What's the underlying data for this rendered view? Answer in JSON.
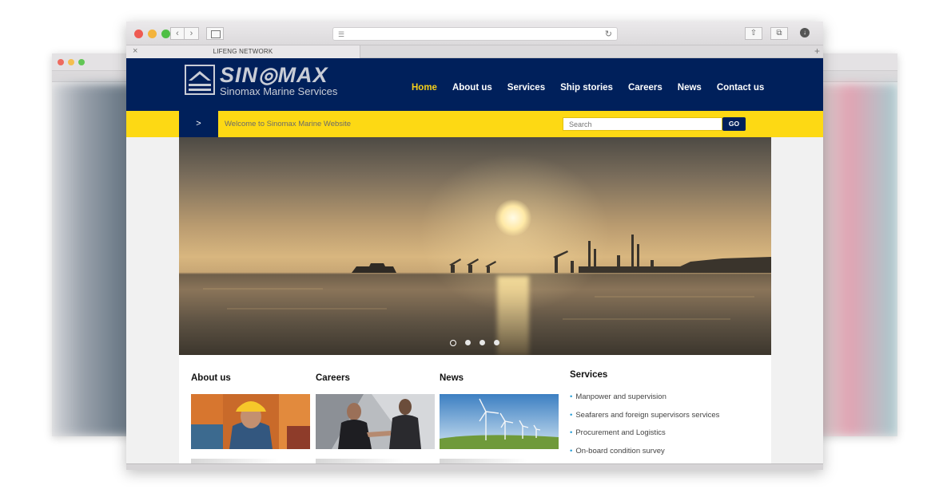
{
  "browser": {
    "tab_title": "LIFENG NETWORK"
  },
  "site": {
    "brand_name": "SIN◎MAX",
    "brand_sub": "Sinomax Marine Services",
    "nav": [
      {
        "label": "Home",
        "active": true
      },
      {
        "label": "About us",
        "active": false
      },
      {
        "label": "Services",
        "active": false
      },
      {
        "label": "Ship stories",
        "active": false
      },
      {
        "label": "Careers",
        "active": false
      },
      {
        "label": "News",
        "active": false
      },
      {
        "label": "Contact us",
        "active": false
      }
    ],
    "yellow_button": ">",
    "welcome": "Welcome to Sinomax Marine Website",
    "search_placeholder": "Search",
    "go_label": "GO",
    "sections": {
      "about": "About us",
      "careers": "Careers",
      "news": "News",
      "services": "Services"
    },
    "services_list": [
      "Manpower and supervision",
      "Seafarers and foreign supervisors services",
      "Procurement and Logistics",
      "On-board condition survey"
    ],
    "bullet": "•"
  },
  "colors": {
    "header_bg": "#00205b",
    "accent_yellow": "#fdd914",
    "nav_active": "#f6cf19",
    "bullet_blue": "#2a9fd6"
  },
  "slider": {
    "active_index": 0,
    "dot_count": 4
  }
}
